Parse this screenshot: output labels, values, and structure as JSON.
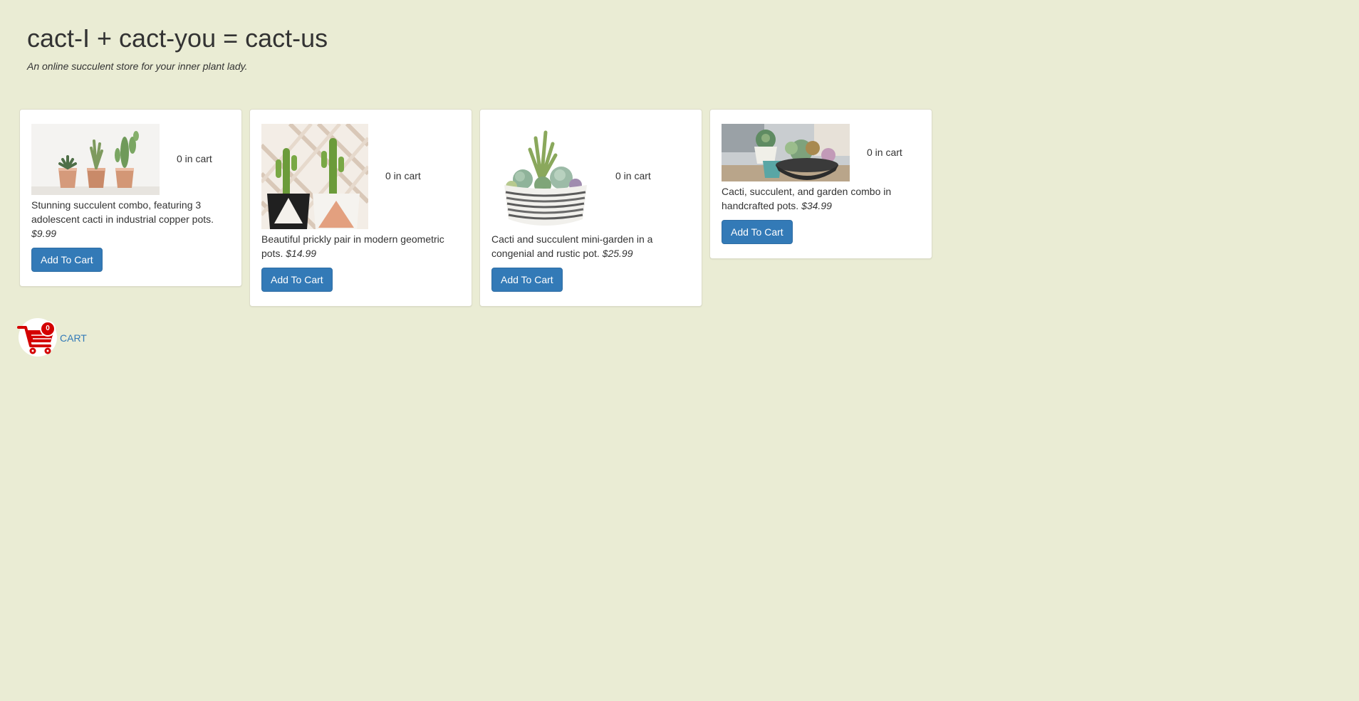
{
  "header": {
    "title": "cact-I + cact-you = cact-us",
    "tagline": "An online succulent store for your inner plant lady."
  },
  "products": [
    {
      "in_cart": "0 in cart",
      "description": "Stunning succulent combo, featuring 3 adolescent cacti in industrial copper pots.",
      "price": "$9.99",
      "button_label": "Add To Cart"
    },
    {
      "in_cart": "0 in cart",
      "description": "Beautiful prickly pair in modern geometric pots.",
      "price": "$14.99",
      "button_label": "Add To Cart"
    },
    {
      "in_cart": "0 in cart",
      "description": "Cacti and succulent mini-garden in a congenial and rustic pot.",
      "price": "$25.99",
      "button_label": "Add To Cart"
    },
    {
      "in_cart": "0 in cart",
      "description": "Cacti, succulent, and garden combo in handcrafted pots.",
      "price": "$34.99",
      "button_label": "Add To Cart"
    }
  ],
  "cart": {
    "count": "0",
    "label": "CART",
    "icon": "shopping-cart-icon"
  },
  "colors": {
    "background": "#eaecd4",
    "button": "#337ab7",
    "cart_icon": "#d40000",
    "link": "#337ab7"
  }
}
